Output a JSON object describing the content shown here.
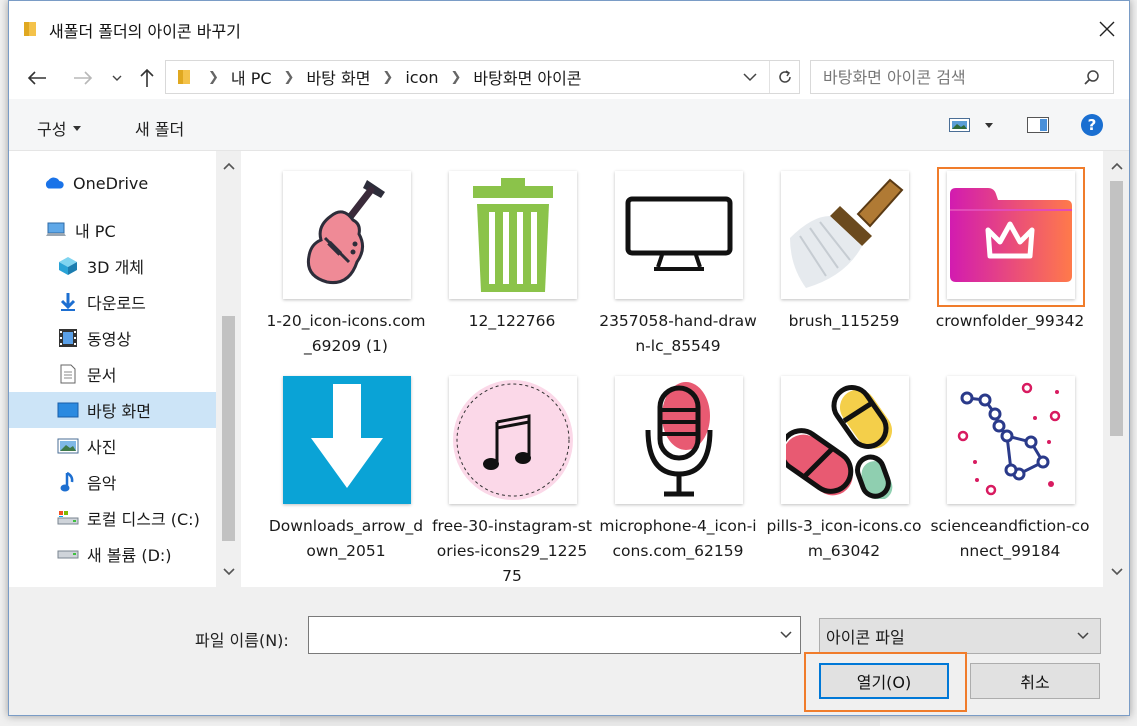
{
  "dialog": {
    "title": "새폴더 폴더의 아이콘 바꾸기"
  },
  "address": {
    "crumbs": [
      "내 PC",
      "바탕 화면",
      "icon",
      "바탕화면 아이콘"
    ]
  },
  "search": {
    "placeholder": "바탕화면 아이콘 검색"
  },
  "toolbar": {
    "organize_label": "구성",
    "new_folder_label": "새 폴더"
  },
  "sidebar": {
    "items": [
      {
        "label": "OneDrive",
        "icon": "onedrive-cloud-icon"
      },
      {
        "label": "내 PC",
        "icon": "computer-icon"
      },
      {
        "label": "3D 개체",
        "icon": "3d-objects-icon"
      },
      {
        "label": "다운로드",
        "icon": "download-arrow-icon"
      },
      {
        "label": "동영상",
        "icon": "video-film-icon"
      },
      {
        "label": "문서",
        "icon": "document-icon"
      },
      {
        "label": "바탕 화면",
        "icon": "desktop-icon"
      },
      {
        "label": "사진",
        "icon": "pictures-icon"
      },
      {
        "label": "음악",
        "icon": "music-note-icon"
      },
      {
        "label": "로컬 디스크 (C:)",
        "icon": "drive-c-icon"
      },
      {
        "label": "새 볼륨 (D:)",
        "icon": "drive-d-icon"
      }
    ]
  },
  "files": [
    {
      "name": "1-20_icon-icons.com_69209 (1)",
      "icon": "guitar-icon"
    },
    {
      "name": "12_122766",
      "icon": "trash-can-icon"
    },
    {
      "name": "2357058-hand-drawn-lc_85549",
      "icon": "monitor-icon"
    },
    {
      "name": "brush_115259",
      "icon": "brush-icon"
    },
    {
      "name": "crownfolder_99342",
      "icon": "crown-folder-icon"
    },
    {
      "name": "Downloads_arrow_down_2051",
      "icon": "download-arrow-icon"
    },
    {
      "name": "free-30-instagram-stories-icons29_122575",
      "icon": "music-note-icon"
    },
    {
      "name": "microphone-4_icon-icons.com_62159",
      "icon": "microphone-icon"
    },
    {
      "name": "pills-3_icon-icons.com_63042",
      "icon": "pills-icon"
    },
    {
      "name": "scienceandfiction-connect_99184",
      "icon": "constellation-icon"
    }
  ],
  "bottom": {
    "filename_label": "파일 이름(N):",
    "filename_value": "",
    "filetype_selected": "아이콘 파일",
    "open_label": "열기(O)",
    "cancel_label": "취소"
  }
}
